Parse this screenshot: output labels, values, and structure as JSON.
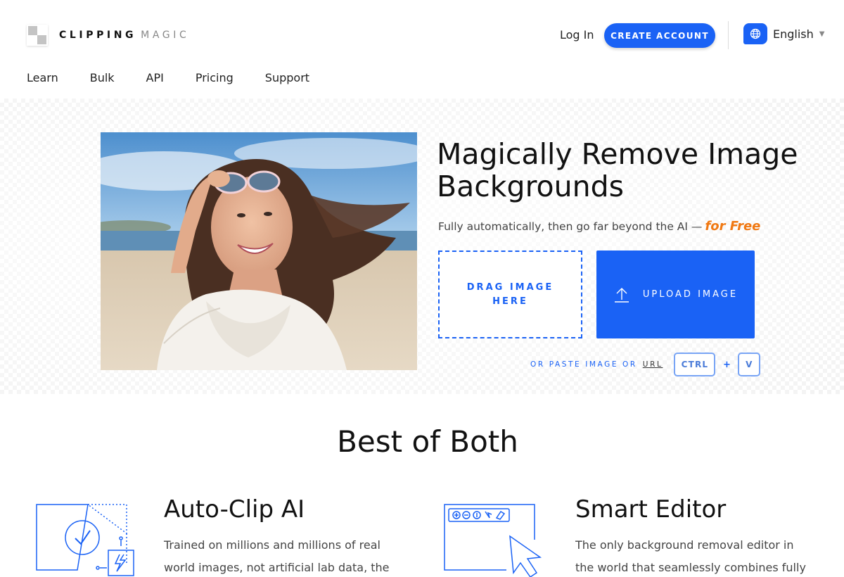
{
  "header": {
    "logo_bold": "CLIPPING",
    "logo_light": "MAGIC",
    "login_label": "Log In",
    "create_account_label": "CREATE ACCOUNT",
    "language_label": "English"
  },
  "nav": {
    "items": [
      "Learn",
      "Bulk",
      "API",
      "Pricing",
      "Support"
    ]
  },
  "hero": {
    "title": "Magically Remove Image Backgrounds",
    "subtitle": "Fully automatically, then go far beyond the AI —",
    "subtitle_emphasis": "for Free",
    "drag_label": "DRAG IMAGE HERE",
    "upload_label": "UPLOAD IMAGE",
    "paste_text": "OR PASTE IMAGE OR",
    "url_link": "URL",
    "key_ctrl": "CTRL",
    "key_plus": "+",
    "key_v": "V"
  },
  "features": {
    "section_title": "Best of Both",
    "items": [
      {
        "title": "Auto-Clip AI",
        "description": "Trained on millions and millions of real world images, not artificial lab data, the",
        "icon": "auto-clip-icon"
      },
      {
        "title": "Smart Editor",
        "description": "The only background removal editor in the world that seamlessly combines fully",
        "icon": "smart-editor-icon"
      }
    ]
  },
  "colors": {
    "accent": "#1a62f5",
    "free_orange": "#f07812"
  }
}
